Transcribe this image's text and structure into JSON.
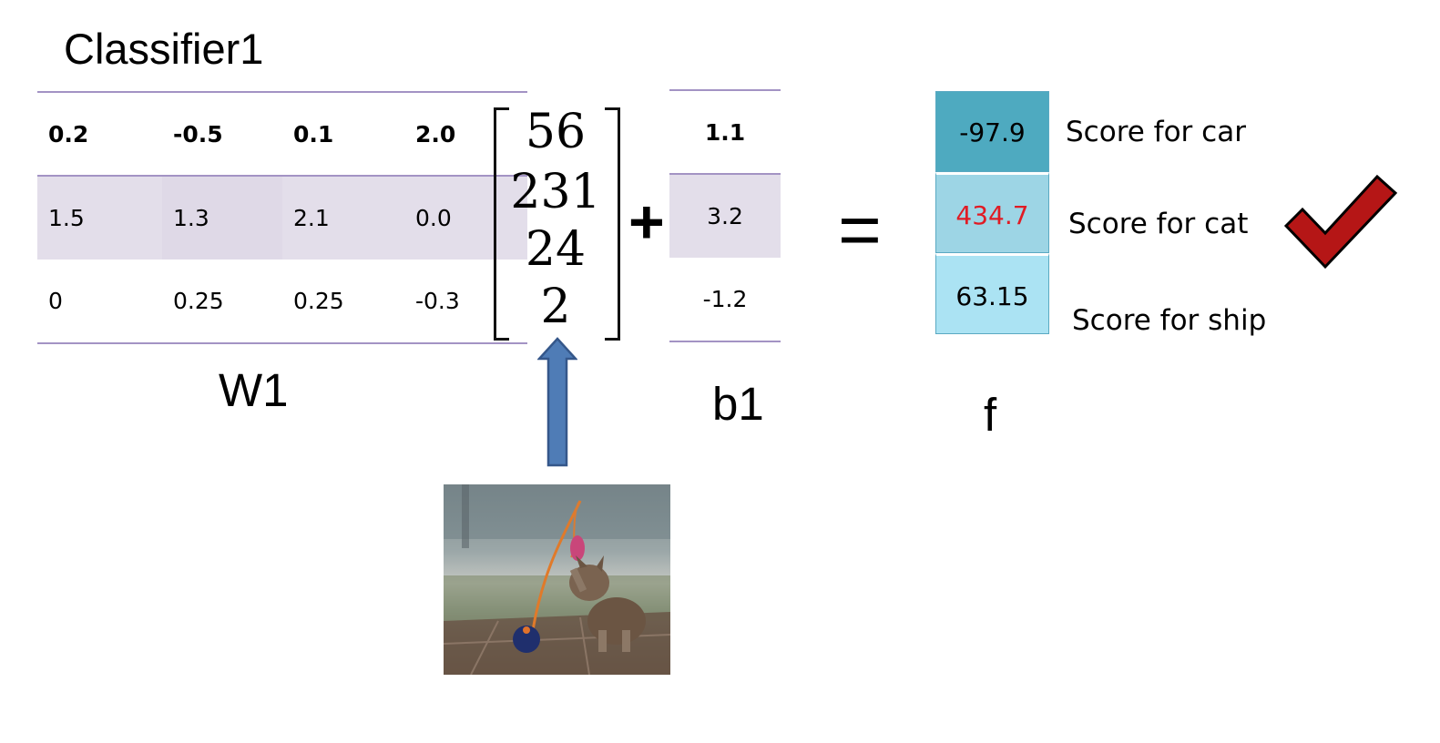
{
  "title": "Classifier1",
  "W1": {
    "caption": "W1",
    "rows": [
      [
        "0.2",
        "-0.5",
        "0.1",
        "2.0"
      ],
      [
        "1.5",
        "1.3",
        "2.1",
        "0.0"
      ],
      [
        "0",
        "0.25",
        "0.25",
        "-0.3"
      ]
    ]
  },
  "x_vector": [
    "56",
    "231",
    "24",
    "2"
  ],
  "plus_sign": "+",
  "b1": {
    "caption": "b1",
    "values": [
      "1.1",
      "3.2",
      "-1.2"
    ]
  },
  "equals_sign": "=",
  "f": {
    "caption": "f",
    "scores": [
      {
        "value": "-97.9",
        "label": "Score for car",
        "bg": "#4eaac0",
        "text_color": "#000000"
      },
      {
        "value": "434.7",
        "label": "Score for cat",
        "bg": "#9dd5e5",
        "text_color": "#e01b24"
      },
      {
        "value": "63.15",
        "label": "Score for ship",
        "bg": "#abe3f3",
        "text_color": "#000000"
      }
    ]
  },
  "colors": {
    "table_rule": "#a393c4",
    "table_band": "#e3deea",
    "arrow_fill": "#4f7cb6",
    "arrow_stroke": "#35578a",
    "check_fill": "#b51616",
    "check_stroke": "#000000"
  },
  "icons": {
    "checkmark": "checkmark-icon",
    "input_arrow": "up-arrow-icon",
    "input_image": "kitten-photo"
  }
}
